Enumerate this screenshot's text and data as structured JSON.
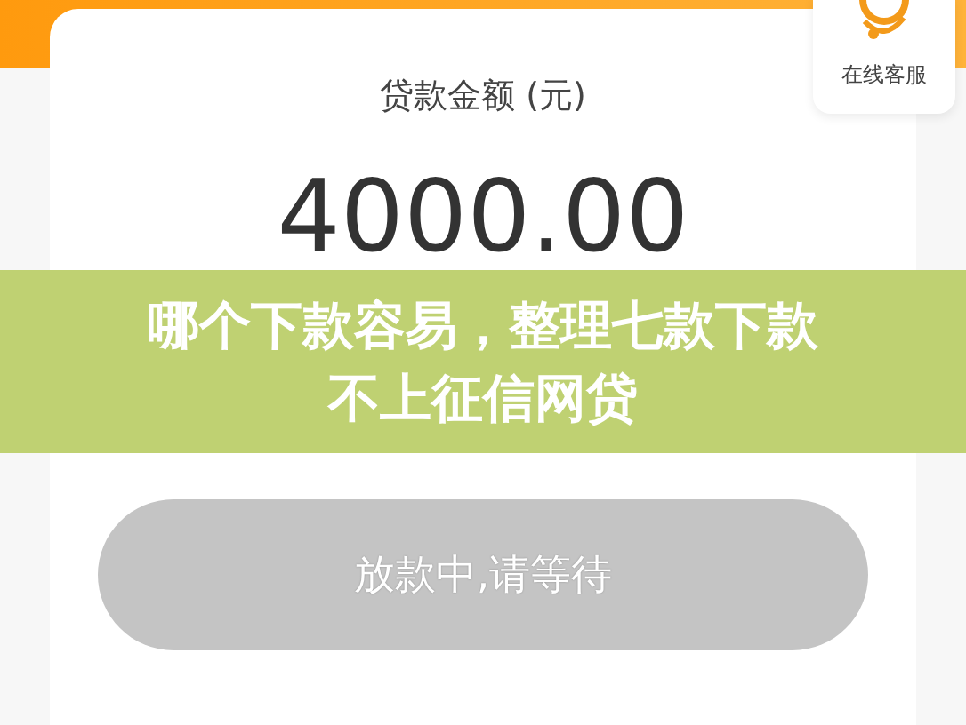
{
  "service": {
    "label": "在线客服"
  },
  "loan": {
    "label": "贷款金额 (元)",
    "amount": "4000.00"
  },
  "banner": {
    "lines": [
      "哪个下款容易，整理七款下款",
      "不上征信网贷"
    ]
  },
  "button": {
    "label": "放款中,请等待",
    "disabled": true
  }
}
